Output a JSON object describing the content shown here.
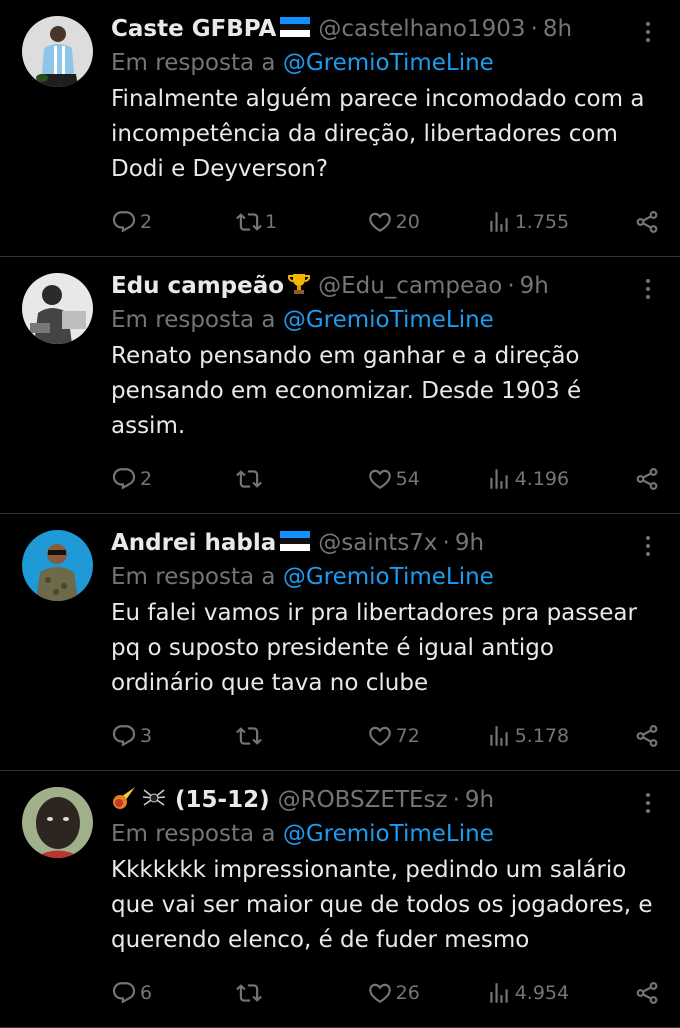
{
  "reply_prefix": "Em resposta a",
  "tweets": [
    {
      "name": "Caste GFBPA",
      "name_emoji": "estonia-flag",
      "handle": "@castelhano1903",
      "separator": "·",
      "time": "8h",
      "reply_to": "@GremioTimeLine",
      "text": "Finalmente alguém parece incomodado com a incompetência da direção, libertadores com Dodi e Deyverson?",
      "replies": "2",
      "retweets": "1",
      "likes": "20",
      "views": "1.755"
    },
    {
      "name": "Edu campeão",
      "name_emoji": "trophy",
      "handle": "@Edu_campeao",
      "separator": "·",
      "time": "9h",
      "reply_to": "@GremioTimeLine",
      "text": "Renato pensando em ganhar e a direção pensando em economizar.  Desde 1903 é assim.",
      "replies": "2",
      "retweets": "",
      "likes": "54",
      "views": "4.196"
    },
    {
      "name": "Andrei habla",
      "name_emoji": "estonia-flag",
      "handle": "@saints7x",
      "separator": "·",
      "time": "9h",
      "reply_to": "@GremioTimeLine",
      "text": "Eu falei vamos ir pra libertadores pra passear pq o suposto presidente é igual antigo ordinário que tava no clube",
      "replies": "3",
      "retweets": "",
      "likes": "72",
      "views": "5.178"
    },
    {
      "name": "(15-12)",
      "name_emoji_prefix": [
        "comet",
        "spider"
      ],
      "handle": "@ROBSZETEsz",
      "separator": "·",
      "time": "9h",
      "reply_to": "@GremioTimeLine",
      "text": "Kkkkkkk impressionante, pedindo um salário que vai ser maior que de todos os jogadores, e querendo elenco, é de fuder mesmo",
      "replies": "6",
      "retweets": "",
      "likes": "26",
      "views": "4.954"
    }
  ],
  "colors": {
    "background": "#000000",
    "primary_text": "#e7e9ea",
    "secondary_text": "#71767b",
    "link": "#1d9bf0",
    "divider": "#2f3336"
  }
}
